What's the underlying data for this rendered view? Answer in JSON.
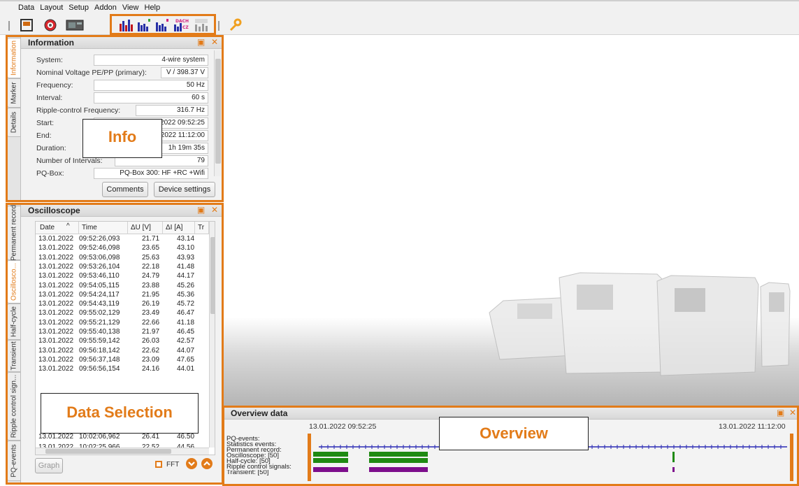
{
  "menu": [
    "Data",
    "Layout",
    "Setup",
    "Addon",
    "View",
    "Help"
  ],
  "toolbar": {
    "buttons": [
      "save-icon",
      "disc-icon",
      "device-icon"
    ],
    "report_buttons": [
      "report-bar-icon",
      "report-bar-green-icon",
      "report-bar-pink-icon",
      "dach-cz-report-icon",
      "standard-report-icon"
    ],
    "dach_label": "DACH",
    "cz_label": "CZ",
    "wrench": "wrench-icon"
  },
  "info_panel": {
    "title": "Information",
    "tabs": [
      "Information",
      "Marker",
      "Details"
    ],
    "rows": [
      {
        "label": "System:",
        "value": "4-wire system"
      },
      {
        "label": "Nominal Voltage PE/PP (primary):",
        "value": "V / 398.37 V"
      },
      {
        "label": "Frequency:",
        "value": "50 Hz"
      },
      {
        "label": "Interval:",
        "value": "60 s"
      },
      {
        "label": "Ripple-control Frequency:",
        "value": "316.7 Hz"
      },
      {
        "label": "Start:",
        "value": "13.01.2022 09:52:25"
      },
      {
        "label": "End:",
        "value": "13.01.2022 11:12:00"
      },
      {
        "label": "Duration:",
        "value": "1h 19m 35s"
      },
      {
        "label": "Number of Intervals:",
        "value": "79"
      },
      {
        "label": "PQ-Box:",
        "value": "PQ-Box 300: HF +RC +Wifi"
      }
    ],
    "comments_button": "Comments",
    "device_settings_button": "Device settings",
    "callout": "Info"
  },
  "osc_panel": {
    "title": "Oscilloscope",
    "tabs": [
      "Permanent record",
      "Oscillosco...",
      "Half-cycle",
      "Transient",
      "Ripple control sign...",
      "PQ-events"
    ],
    "columns": [
      "Date",
      "Time",
      "ΔU [V]",
      "ΔI [A]",
      "Tr"
    ],
    "rows": [
      [
        "13.01.2022",
        "09:52:26,093",
        "21.71",
        "43.14"
      ],
      [
        "13.01.2022",
        "09:52:46,098",
        "23.65",
        "43.10"
      ],
      [
        "13.01.2022",
        "09:53:06,098",
        "25.63",
        "43.93"
      ],
      [
        "13.01.2022",
        "09:53:26,104",
        "22.18",
        "41.48"
      ],
      [
        "13.01.2022",
        "09:53:46,110",
        "24.79",
        "44.17"
      ],
      [
        "13.01.2022",
        "09:54:05,115",
        "23.88",
        "45.26"
      ],
      [
        "13.01.2022",
        "09:54:24,117",
        "21.95",
        "45.36"
      ],
      [
        "13.01.2022",
        "09:54:43,119",
        "26.19",
        "45.72"
      ],
      [
        "13.01.2022",
        "09:55:02,129",
        "23.49",
        "46.47"
      ],
      [
        "13.01.2022",
        "09:55:21,129",
        "22.66",
        "41.18"
      ],
      [
        "13.01.2022",
        "09:55:40,138",
        "21.97",
        "46.45"
      ],
      [
        "13.01.2022",
        "09:55:59,142",
        "26.03",
        "42.57"
      ],
      [
        "13.01.2022",
        "09:56:18,142",
        "22.62",
        "44.07"
      ],
      [
        "13.01.2022",
        "09:56:37,148",
        "23.09",
        "47.65"
      ],
      [
        "13.01.2022",
        "09:56:56,154",
        "24.16",
        "44.01"
      ]
    ],
    "last_row": [
      "13.01.2022",
      "10:02:06,962",
      "26.41",
      "46.50"
    ],
    "partial_row": [
      "13.01.2022",
      "10:02:25,966",
      "22.52",
      "44.56"
    ],
    "graph_button": "Graph",
    "fft_label": "FFT",
    "callout": "Data Selection"
  },
  "overview": {
    "title": "Overview data",
    "start": "13.01.2022 09:52:25",
    "end": "13.01.2022 11:12:00",
    "labels": [
      "PQ-events:",
      "Statistics events:",
      "Permanent record:",
      "Oscilloscope: [50]",
      "Half-cycle: [50]",
      "Ripple control signals:",
      "Transient: [50]"
    ],
    "callout": "Overview"
  },
  "colors": {
    "accent": "#e27b19",
    "green": "#1f8a12",
    "purple": "#7d0e8c",
    "blue": "#2a2ab4"
  }
}
